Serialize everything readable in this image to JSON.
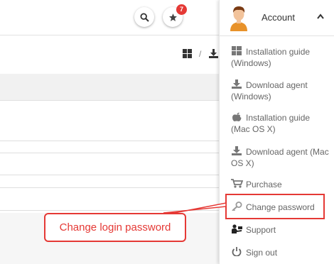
{
  "header": {
    "notification_count": "7",
    "search_icon": "search-icon",
    "notifications_icon": "star-icon"
  },
  "toolbar": {
    "icons": [
      "windows-icon",
      "download-icon"
    ],
    "separator": "/"
  },
  "account": {
    "name": "Account",
    "avatar_icon": "user-avatar",
    "toggle_icon": "chevron-up-icon"
  },
  "menu": {
    "items": [
      {
        "label": "Installation guide (Windows)",
        "icon": "windows-icon"
      },
      {
        "label": "Download agent (Windows)",
        "icon": "download-icon"
      },
      {
        "label": "Installation guide (Mac OS X)",
        "icon": "apple-icon"
      },
      {
        "label": "Download agent (Mac OS X)",
        "icon": "download-icon"
      },
      {
        "label": "Purchase",
        "icon": "cart-icon"
      },
      {
        "label": "Change password",
        "icon": "key-icon"
      },
      {
        "label": "Support",
        "icon": "support-icon"
      },
      {
        "label": "Sign out",
        "icon": "power-icon"
      }
    ]
  },
  "annotation": {
    "callout_text": "Change login password"
  },
  "colors": {
    "accent_red": "#e53935",
    "menu_text": "#666666",
    "icon_gray": "#777777"
  }
}
